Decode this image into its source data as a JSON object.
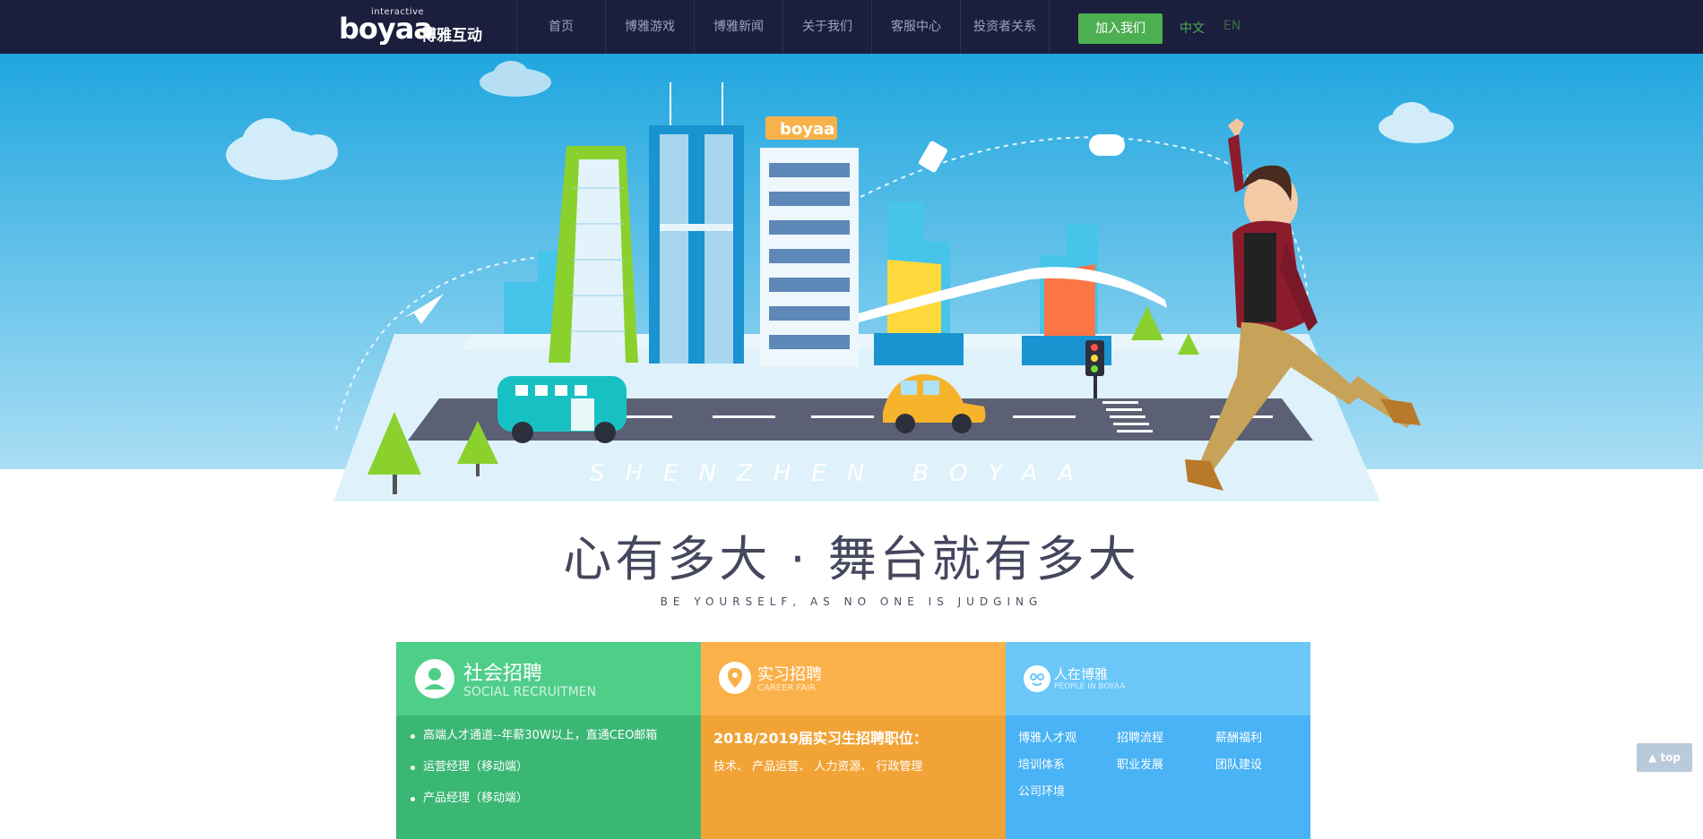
{
  "header": {
    "logo_small": "interactive",
    "logo_big": "boyaa",
    "logo_cn": "博雅互动",
    "nav": [
      "首页",
      "博雅游戏",
      "博雅新闻",
      "关于我们",
      "客服中心",
      "投资者关系"
    ],
    "join_label": "加入我们",
    "lang_cn": "中文",
    "lang_en": "EN",
    "colors": {
      "bar": "#1b1e3d",
      "join": "#4caf50"
    }
  },
  "hero": {
    "sign_text": "boyaa",
    "road_text": "SHENZHEN BOYAA"
  },
  "slogan": {
    "main": "心有多大 · 舞台就有多大",
    "sub": "BE YOURSELF, AS NO ONE IS JUDGING"
  },
  "cards": {
    "social": {
      "title": "社会招聘",
      "subtitle": "SOCIAL RECRUITMENT",
      "items": [
        "高端人才通道--年薪30W以上，直通CEO邮箱",
        "运营经理（移动端）",
        "产品经理（移动端）"
      ],
      "icon": "person-icon"
    },
    "intern": {
      "title": "实习招聘",
      "subtitle": "CAREER FAIR",
      "heading": "2018/2019届实习生招聘职位：",
      "jobs": "技术、 产品运营、 人力资源、 行政管理",
      "icon": "location-star-icon"
    },
    "people": {
      "title": "人在博雅",
      "subtitle": "PEOPLE IN BOYAA",
      "links": [
        "博雅人才观",
        "招聘流程",
        "薪酬福利",
        "培训体系",
        "职业发展",
        "团队建设",
        "公司环境"
      ],
      "icon": "boyaa-face-icon"
    }
  },
  "top_button": "top"
}
